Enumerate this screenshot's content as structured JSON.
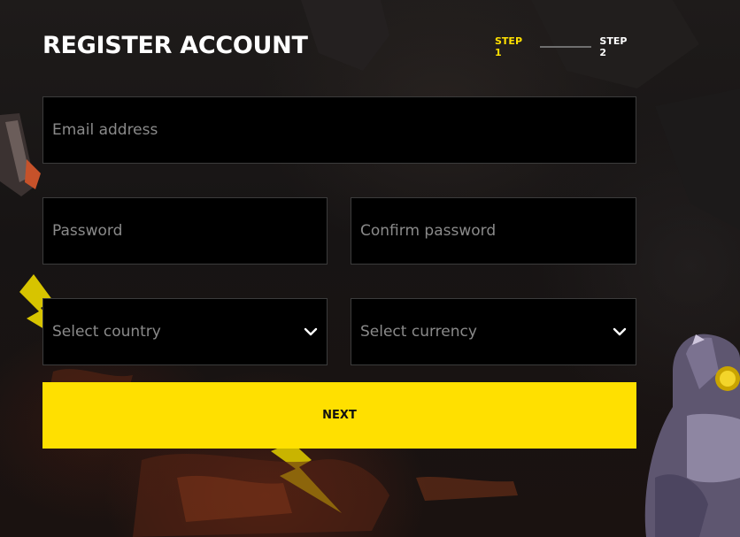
{
  "header": {
    "title": "REGISTER ACCOUNT",
    "steps": [
      {
        "label": "STEP 1",
        "active": true
      },
      {
        "label": "STEP 2",
        "active": false
      }
    ]
  },
  "form": {
    "email": {
      "placeholder": "Email address",
      "value": ""
    },
    "password": {
      "placeholder": "Password",
      "value": ""
    },
    "confirm_password": {
      "placeholder": "Confirm password",
      "value": ""
    },
    "country": {
      "selected": "Select country",
      "icon": "chevron-down-icon"
    },
    "currency": {
      "selected": "Select currency",
      "icon": "chevron-down-icon"
    },
    "next_label": "NEXT"
  },
  "colors": {
    "accent": "#ffe000",
    "field_bg": "#000000",
    "field_border": "#3c3c3c",
    "placeholder": "#8a8a8a",
    "text": "#ffffff"
  }
}
